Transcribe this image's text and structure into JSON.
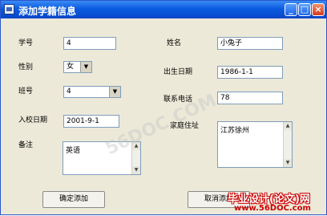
{
  "window": {
    "title": "添加学籍信息"
  },
  "title_buttons": {
    "minimize": "_",
    "maximize": "□",
    "close": "×"
  },
  "labels": {
    "student_id": "学号",
    "gender": "性别",
    "class_no": "班号",
    "enroll_date": "入校日期",
    "remarks": "备注",
    "name": "姓名",
    "birth_date": "出生日期",
    "phone": "联系电话",
    "address": "家庭住址"
  },
  "fields": {
    "student_id": "4",
    "gender": "女",
    "class_no": "4",
    "enroll_date": "2001-9-1",
    "remarks": "英语",
    "name": "小兔子",
    "birth_date": "1986-1-1",
    "phone": "78",
    "address": "江苏徐州"
  },
  "buttons": {
    "confirm": "确定添加",
    "cancel": "取消添加"
  },
  "watermark": {
    "text": "56DOC.COM"
  },
  "corner_logo": {
    "main": "毕业设计(论文)网",
    "sub": "www.56DOC.com"
  }
}
